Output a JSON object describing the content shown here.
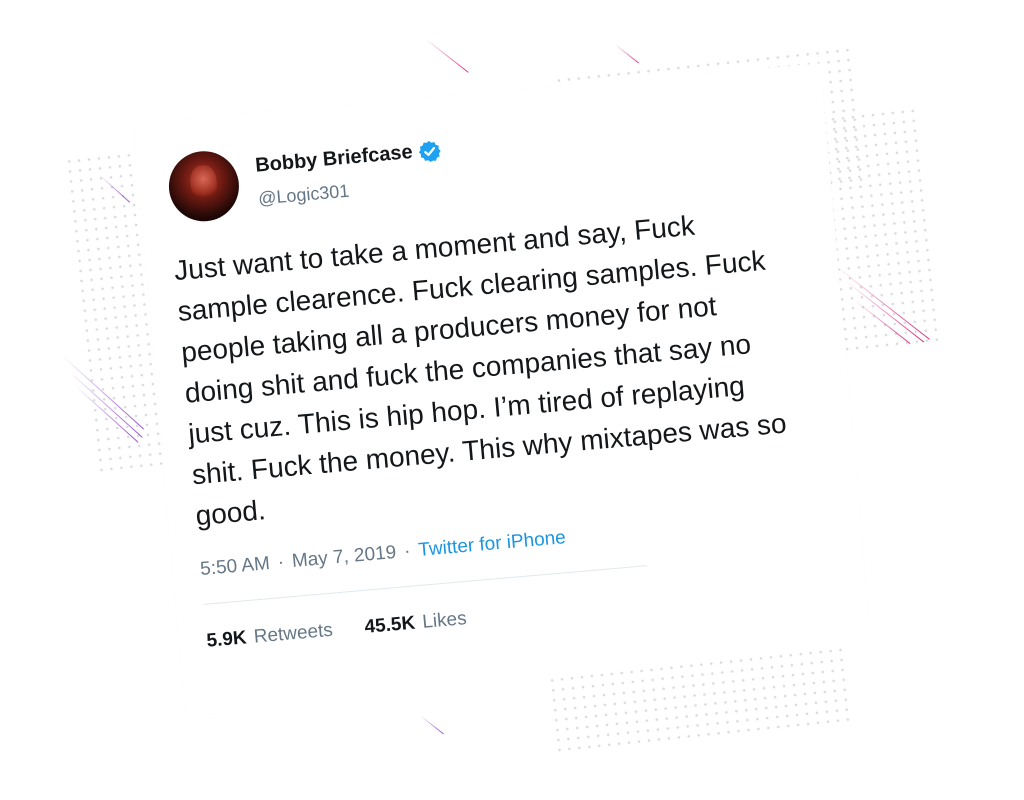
{
  "tweet": {
    "display_name": "Bobby Briefcase",
    "handle": "@Logic301",
    "verified": true,
    "text": "Just want to take a moment and say, Fuck sample clearence. Fuck clearing samples. Fuck people taking all a producers money for not doing shit and fuck the companies that say no just cuz. This is hip hop. I’m tired of replaying shit. Fuck the money. This why mixtapes was so good.",
    "time": "5:50 AM",
    "separator": "·",
    "date": "May 7, 2019",
    "source": "Twitter for iPhone",
    "retweets_count": "5.9K",
    "retweets_label": "Retweets",
    "likes_count": "45.5K",
    "likes_label": "Likes"
  },
  "colors": {
    "verified_badge": "#1da1f2",
    "source_link": "#1b95e0",
    "muted_text": "#657786",
    "main_text": "#14171a",
    "accent_pink": "#d61978",
    "accent_purple": "#8c3cc8"
  },
  "icons": {
    "verified": "verified-badge-icon",
    "avatar": "profile-avatar"
  }
}
